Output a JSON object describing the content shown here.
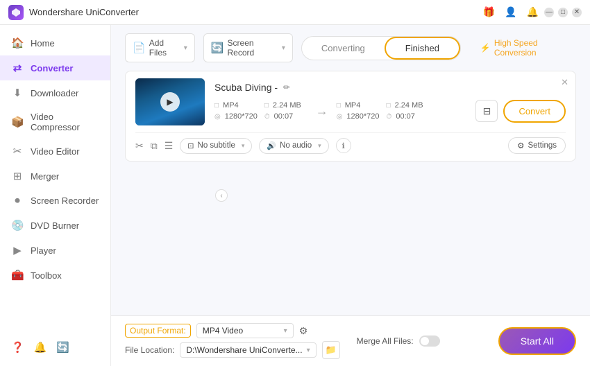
{
  "app": {
    "title": "Wondershare UniConverter",
    "logo_color": "#7c3aed"
  },
  "titlebar": {
    "icons": [
      "gift-icon",
      "user-icon",
      "bell-icon",
      "minimize-icon",
      "maximize-icon",
      "close-icon"
    ]
  },
  "sidebar": {
    "items": [
      {
        "id": "home",
        "label": "Home",
        "icon": "🏠"
      },
      {
        "id": "converter",
        "label": "Converter",
        "icon": "⇄",
        "active": true
      },
      {
        "id": "downloader",
        "label": "Downloader",
        "icon": "⬇"
      },
      {
        "id": "video-compressor",
        "label": "Video Compressor",
        "icon": "📦"
      },
      {
        "id": "video-editor",
        "label": "Video Editor",
        "icon": "✂"
      },
      {
        "id": "merger",
        "label": "Merger",
        "icon": "⊞"
      },
      {
        "id": "screen-recorder",
        "label": "Screen Recorder",
        "icon": "⏺"
      },
      {
        "id": "dvd-burner",
        "label": "DVD Burner",
        "icon": "💿"
      },
      {
        "id": "player",
        "label": "Player",
        "icon": "▶"
      },
      {
        "id": "toolbox",
        "label": "Toolbox",
        "icon": "🧰"
      }
    ],
    "bottom_icons": [
      "help-icon",
      "bell-icon",
      "refresh-icon"
    ]
  },
  "toolbar": {
    "add_files_label": "Add Files",
    "add_files_dropdown": true,
    "screen_record_label": "Screen Record",
    "screen_record_dropdown": true
  },
  "tabs": {
    "converting_label": "Converting",
    "finished_label": "Finished",
    "active": "finished"
  },
  "high_speed": {
    "label": "High Speed Conversion",
    "icon": "⚡"
  },
  "file_card": {
    "title": "Scuba Diving -",
    "source": {
      "format": "MP4",
      "resolution": "1280*720",
      "size": "2.24 MB",
      "duration": "00:07"
    },
    "destination": {
      "format": "MP4",
      "resolution": "1280*720",
      "size": "2.24 MB",
      "duration": "00:07"
    },
    "subtitle_label": "No subtitle",
    "audio_label": "No audio",
    "settings_label": "Settings",
    "convert_btn_label": "Convert"
  },
  "bottom_bar": {
    "output_format_label": "Output Format:",
    "output_format_value": "MP4 Video",
    "file_location_label": "File Location:",
    "file_location_value": "D:\\Wondershare UniConverte...",
    "merge_all_label": "Merge All Files:",
    "start_all_label": "Start All"
  }
}
